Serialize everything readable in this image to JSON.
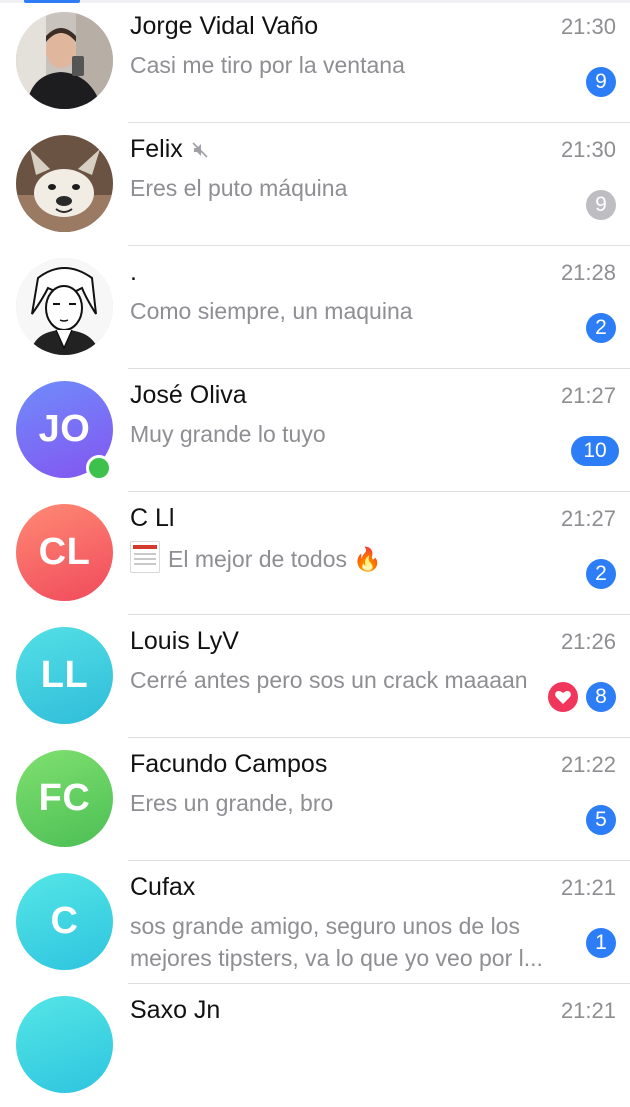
{
  "chats": [
    {
      "name": "Jorge Vidal Vaño",
      "time": "21:30",
      "preview": "Casi me tiro por la ventana",
      "unread": "9",
      "avatar": {
        "type": "photo",
        "icon": "person-photo"
      }
    },
    {
      "name": "Felix",
      "time": "21:30",
      "preview": "Eres el puto máquina",
      "unread": "9",
      "muted": true,
      "avatar": {
        "type": "photo",
        "icon": "dog-photo"
      }
    },
    {
      "name": ".",
      "time": "21:28",
      "preview": "Como siempre, un maquina",
      "unread": "2",
      "avatar": {
        "type": "photo",
        "icon": "anime-drawing"
      }
    },
    {
      "name": "José Oliva",
      "time": "21:27",
      "preview": "Muy grande lo tuyo",
      "unread": "10",
      "avatar": {
        "type": "initials",
        "initials": "JO",
        "colors": [
          "#6f8cfb",
          "#8455f0"
        ]
      },
      "online": true
    },
    {
      "name": "C Ll",
      "time": "21:27",
      "preview": "El mejor de todos",
      "preview_emoji": "🔥",
      "unread": "2",
      "avatar": {
        "type": "initials",
        "initials": "CL",
        "colors": [
          "#ff8a74",
          "#f04a5c"
        ]
      }
    },
    {
      "name": "Louis LyV",
      "time": "21:26",
      "preview": "Cerré antes pero sos un crack maaaan",
      "unread": "8",
      "reaction": "heart-icon",
      "avatar": {
        "type": "initials",
        "initials": "LL",
        "colors": [
          "#54e0e6",
          "#2fbcd9"
        ]
      }
    },
    {
      "name": "Facundo Campos",
      "time": "21:22",
      "preview": "Eres un grande, bro",
      "unread": "5",
      "avatar": {
        "type": "initials",
        "initials": "FC",
        "colors": [
          "#7fe06f",
          "#4cbf55"
        ]
      }
    },
    {
      "name": "Cufax",
      "time": "21:21",
      "preview": "sos grande amigo, seguro unos de los mejores tipsters, va lo que yo veo por l...",
      "unread": "1",
      "avatar": {
        "type": "initials",
        "initials": "C",
        "colors": [
          "#54e6e6",
          "#2ec4df"
        ]
      }
    },
    {
      "name": "Saxo Jn",
      "time": "21:21",
      "avatar": {
        "type": "initials",
        "initials": "",
        "colors": [
          "#54e6e6",
          "#2ec4df"
        ]
      }
    }
  ]
}
